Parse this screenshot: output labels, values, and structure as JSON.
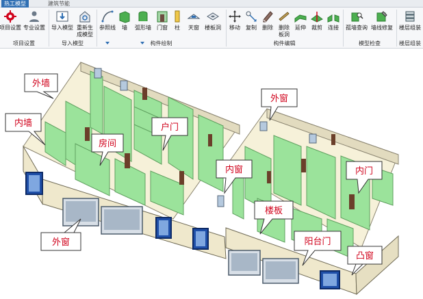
{
  "tabs": [
    {
      "label": "热工模型",
      "active": true
    },
    {
      "label": "建筑节能",
      "active": false
    }
  ],
  "ribbon": {
    "buttons": [
      {
        "id": "project-settings",
        "label": "项目设置"
      },
      {
        "id": "professional-settings",
        "label": "专业设置"
      },
      {
        "id": "import-model",
        "label": "导入模型"
      },
      {
        "id": "regenerate-model",
        "label": "重新生",
        "label2": "成模型"
      },
      {
        "id": "reference-line",
        "label": "参照线"
      },
      {
        "id": "wall",
        "label": "墙"
      },
      {
        "id": "arc-wall",
        "label": "弧形墙"
      },
      {
        "id": "door-window",
        "label": "门窗"
      },
      {
        "id": "column",
        "label": "柱"
      },
      {
        "id": "skylight",
        "label": "天窗"
      },
      {
        "id": "floor-opening",
        "label": "楼板洞"
      },
      {
        "id": "move",
        "label": "移动"
      },
      {
        "id": "copy",
        "label": "复制"
      },
      {
        "id": "delete",
        "label": "删除"
      },
      {
        "id": "delete-slab",
        "label": "删除",
        "label2": "板洞"
      },
      {
        "id": "extend",
        "label": "延伸"
      },
      {
        "id": "trim",
        "label": "裁剪"
      },
      {
        "id": "connect",
        "label": "连接"
      },
      {
        "id": "isolated-wall-query",
        "label": "孤墙查询"
      },
      {
        "id": "wall-line-repair",
        "label": "墙线修复"
      },
      {
        "id": "floor-assembly",
        "label": "楼层组装"
      }
    ],
    "groups": [
      {
        "label": "项目设置"
      },
      {
        "label": "导入模型"
      },
      {
        "label": "构件绘制"
      },
      {
        "label": "构件编辑"
      },
      {
        "label": "模型检查"
      },
      {
        "label": "楼层组装"
      }
    ]
  },
  "callouts": [
    {
      "id": "exterior-wall-1",
      "text": "外墙"
    },
    {
      "id": "interior-wall",
      "text": "内墙"
    },
    {
      "id": "room",
      "text": "房间"
    },
    {
      "id": "unit-door",
      "text": "户门"
    },
    {
      "id": "exterior-window-top",
      "text": "外窗"
    },
    {
      "id": "interior-window",
      "text": "内窗"
    },
    {
      "id": "interior-door",
      "text": "内门"
    },
    {
      "id": "slab",
      "text": "楼板"
    },
    {
      "id": "balcony-door",
      "text": "阳台门"
    },
    {
      "id": "exterior-window-bottom",
      "text": "外窗"
    },
    {
      "id": "bay-window",
      "text": "凸窗"
    }
  ],
  "colors": {
    "accent": "#2f6fb3",
    "wall_green": "#9be39b",
    "floor": "#f6f1d9",
    "wall_exterior": "#efe8cc",
    "callout_text": "#d0021b"
  }
}
